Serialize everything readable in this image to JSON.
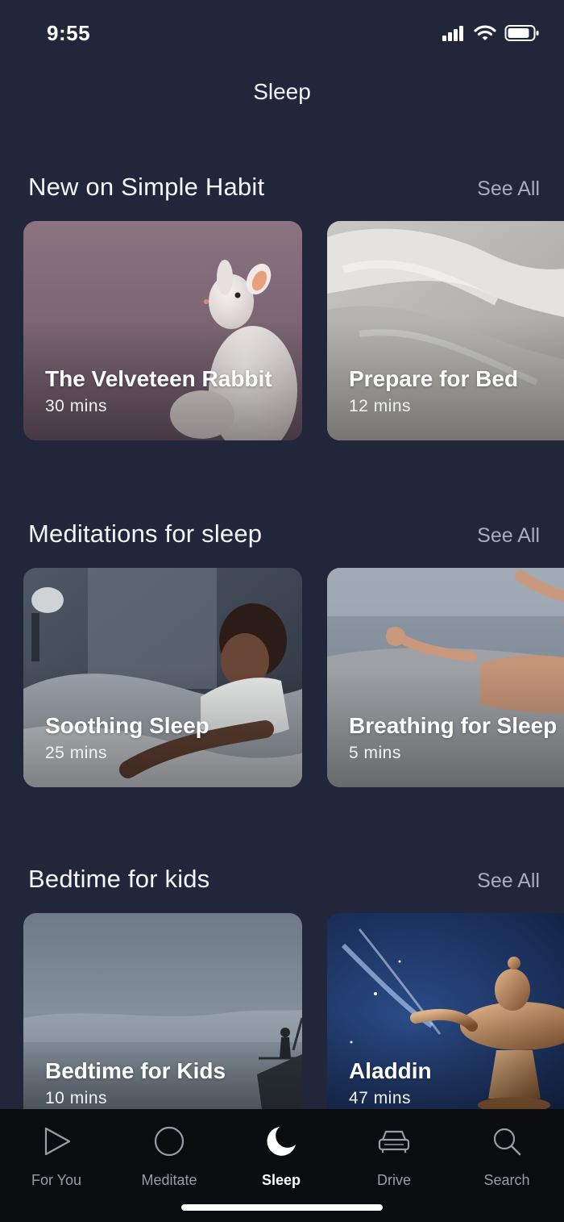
{
  "status_bar": {
    "time": "9:55"
  },
  "page": {
    "title": "Sleep"
  },
  "sections": [
    {
      "title": "New on Simple Habit",
      "see_all": "See All",
      "cards": [
        {
          "title": "The Velveteen Rabbit",
          "duration": "30 mins"
        },
        {
          "title": "Prepare for Bed",
          "duration": "12 mins"
        }
      ]
    },
    {
      "title": "Meditations for sleep",
      "see_all": "See All",
      "cards": [
        {
          "title": "Soothing Sleep",
          "duration": "25 mins"
        },
        {
          "title": "Breathing for Sleep",
          "duration": "5 mins"
        }
      ]
    },
    {
      "title": "Bedtime for kids",
      "see_all": "See All",
      "cards": [
        {
          "title": "Bedtime for Kids",
          "duration": "10 mins"
        },
        {
          "title": "Aladdin",
          "duration": "47 mins"
        }
      ]
    }
  ],
  "tab_bar": {
    "active": "Sleep",
    "tabs": [
      {
        "label": "For You",
        "icon": "play-icon"
      },
      {
        "label": "Meditate",
        "icon": "circle-icon"
      },
      {
        "label": "Sleep",
        "icon": "moon-icon"
      },
      {
        "label": "Drive",
        "icon": "car-icon"
      },
      {
        "label": "Search",
        "icon": "search-icon"
      }
    ]
  },
  "colors": {
    "background": "#21263b",
    "tab_bar": "#0b0c10",
    "muted_text": "#a9adba"
  }
}
